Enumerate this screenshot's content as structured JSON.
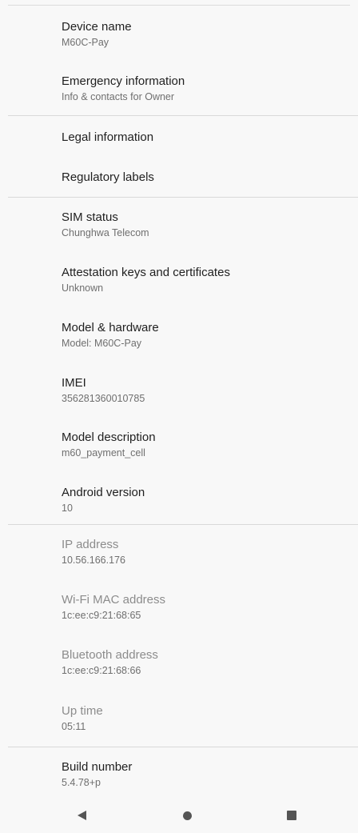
{
  "items": [
    {
      "title": "Device name",
      "subtitle": "M60C-Pay"
    },
    {
      "title": "Emergency information",
      "subtitle": "Info & contacts for Owner"
    },
    {
      "title": "Legal information"
    },
    {
      "title": "Regulatory labels"
    },
    {
      "title": "SIM status",
      "subtitle": "Chunghwa Telecom"
    },
    {
      "title": "Attestation keys and certificates",
      "subtitle": "Unknown"
    },
    {
      "title": "Model & hardware",
      "subtitle": "Model: M60C-Pay"
    },
    {
      "title": "IMEI",
      "subtitle": "356281360010785"
    },
    {
      "title": "Model description",
      "subtitle": "m60_payment_cell"
    },
    {
      "title": "Android version",
      "subtitle": "10"
    },
    {
      "title": "IP address",
      "subtitle": "10.56.166.176"
    },
    {
      "title": "Wi-Fi MAC address",
      "subtitle": "1c:ee:c9:21:68:65"
    },
    {
      "title": "Bluetooth address",
      "subtitle": "1c:ee:c9:21:68:66"
    },
    {
      "title": "Up time",
      "subtitle": "05:11"
    },
    {
      "title": "Build number",
      "subtitle": "5.4.78+p"
    }
  ],
  "navbar": {
    "back_icon": "back-triangle-icon",
    "home_icon": "home-circle-icon",
    "recents_icon": "recents-square-icon"
  }
}
